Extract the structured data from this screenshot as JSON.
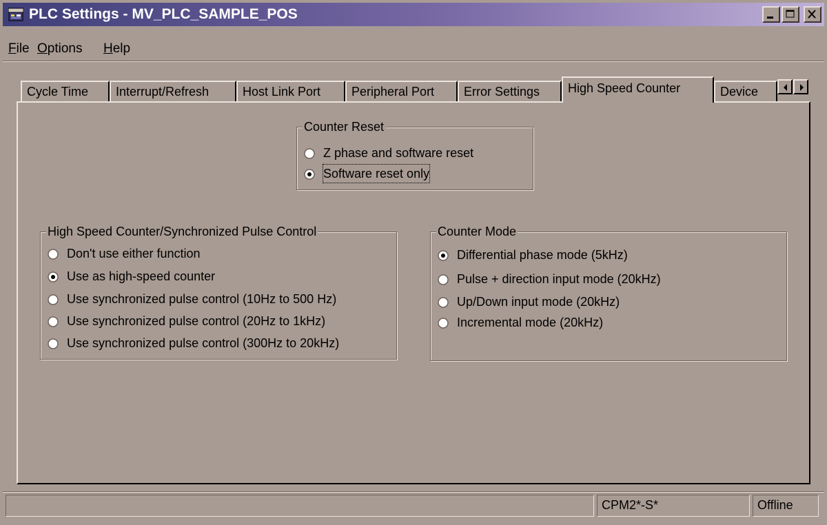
{
  "window": {
    "title": "PLC Settings - MV_PLC_SAMPLE_POS"
  },
  "menu": {
    "items": [
      {
        "acc": "F",
        "rest": "ile"
      },
      {
        "acc": "O",
        "rest": "ptions"
      },
      {
        "acc": "H",
        "rest": "elp"
      }
    ]
  },
  "tabs": [
    {
      "label": "Cycle Time",
      "active": false
    },
    {
      "label": "Interrupt/Refresh",
      "active": false
    },
    {
      "label": "Host Link Port",
      "active": false
    },
    {
      "label": "Peripheral Port",
      "active": false
    },
    {
      "label": "Error Settings",
      "active": false
    },
    {
      "label": "High Speed Counter",
      "active": true
    },
    {
      "label": "Device",
      "active": false
    }
  ],
  "counter_reset": {
    "title": "Counter Reset",
    "options": [
      {
        "label": "Z phase and software reset",
        "selected": false
      },
      {
        "label": "Software reset only",
        "selected": true
      }
    ]
  },
  "hsc_control": {
    "title": "High Speed Counter/Synchronized Pulse Control",
    "options": [
      {
        "label": "Don't use either function",
        "selected": false
      },
      {
        "label": "Use as high-speed counter",
        "selected": true
      },
      {
        "label": "Use synchronized pulse control (10Hz to 500 Hz)",
        "selected": false
      },
      {
        "label": "Use synchronized pulse control (20Hz to 1kHz)",
        "selected": false
      },
      {
        "label": "Use synchronized pulse control (300Hz to 20kHz)",
        "selected": false
      }
    ]
  },
  "counter_mode": {
    "title": "Counter Mode",
    "options": [
      {
        "label": "Differential phase mode (5kHz)",
        "selected": true
      },
      {
        "label": "Pulse + direction input mode (20kHz)",
        "selected": false
      },
      {
        "label": "Up/Down input mode (20kHz)",
        "selected": false
      },
      {
        "label": "Incremental mode (20kHz)",
        "selected": false
      }
    ]
  },
  "status": {
    "model": "CPM2*-S*",
    "connection": "Offline"
  },
  "colors": {
    "face": "#a89b93",
    "title_start": "#3e3e78",
    "title_end": "#bfb0d8"
  }
}
